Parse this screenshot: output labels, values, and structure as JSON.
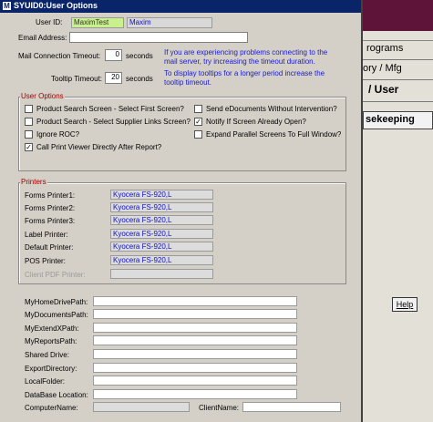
{
  "window": {
    "title": "SYUID0:User Options"
  },
  "user": {
    "id_label": "User ID:",
    "id_value": "MaximTest",
    "name_value": "Maxim",
    "email_label": "Email Address:",
    "email_value": "",
    "mail_timeout_label": "Mail Connection Timeout:",
    "mail_timeout_value": "0",
    "mail_timeout_unit": "seconds",
    "mail_note": "If you are experiencing problems connecting to the mail server, try increasing the timeout duration.",
    "tooltip_timeout_label": "Tooltip Timeout:",
    "tooltip_timeout_value": "20",
    "tooltip_timeout_unit": "seconds",
    "tooltip_note": "To display tooltips for a longer period increase the tooltip timeout."
  },
  "user_options": {
    "title": "User Options",
    "items": [
      {
        "label": "Product Search Screen - Select First Screen?",
        "checked": false
      },
      {
        "label": "Product Search - Select Supplier Links Screen?",
        "checked": false
      },
      {
        "label": "Ignore ROC?",
        "checked": false
      },
      {
        "label": "Call Print Viewer Directly After Report?",
        "checked": true
      },
      {
        "label": "Send eDocuments Without Intervention?",
        "checked": false
      },
      {
        "label": "Notify If Screen Already Open?",
        "checked": true
      },
      {
        "label": "Expand Parallel Screens To Full Window?",
        "checked": false
      }
    ]
  },
  "printers": {
    "title": "Printers",
    "rows": [
      {
        "label": "Forms Printer1:",
        "value": "Kyocera FS-920,L"
      },
      {
        "label": "Forms Printer2:",
        "value": "Kyocera FS-920,L"
      },
      {
        "label": "Forms Printer3:",
        "value": "Kyocera FS-920,L"
      },
      {
        "label": "Label Printer:",
        "value": "Kyocera FS-920,L"
      },
      {
        "label": "Default Printer:",
        "value": "Kyocera FS-920,L"
      },
      {
        "label": "POS Printer:",
        "value": "Kyocera FS-920,L"
      },
      {
        "label": "Client PDF Printer:",
        "value": ""
      }
    ]
  },
  "paths": {
    "home": {
      "label": "MyHomeDrivePath:",
      "value": ""
    },
    "documents": {
      "label": "MyDocumentsPath:",
      "value": ""
    },
    "extendx": {
      "label": "MyExtendXPath:",
      "value": ""
    },
    "reports": {
      "label": "MyReportsPath:",
      "value": ""
    },
    "shared": {
      "label": "Shared Drive:",
      "value": ""
    },
    "export": {
      "label": "ExportDirectory:",
      "value": ""
    },
    "local": {
      "label": "LocalFolder:",
      "value": ""
    },
    "database": {
      "label": "DataBase Location:",
      "value": ""
    },
    "computer": {
      "label": "ComputerName:",
      "value": ""
    },
    "client": {
      "label": "ClientName:",
      "value": ""
    }
  },
  "background_app": {
    "programs": "rograms",
    "inv_mfg": "ory / Mfg",
    "user": "/ User",
    "housekeeping": "sekeeping",
    "help": "Help"
  },
  "colors": {
    "title_bar": "#0a246a",
    "note_text": "#1a1ad6",
    "group_title": "#a00000",
    "printer_text": "#1010c0"
  }
}
